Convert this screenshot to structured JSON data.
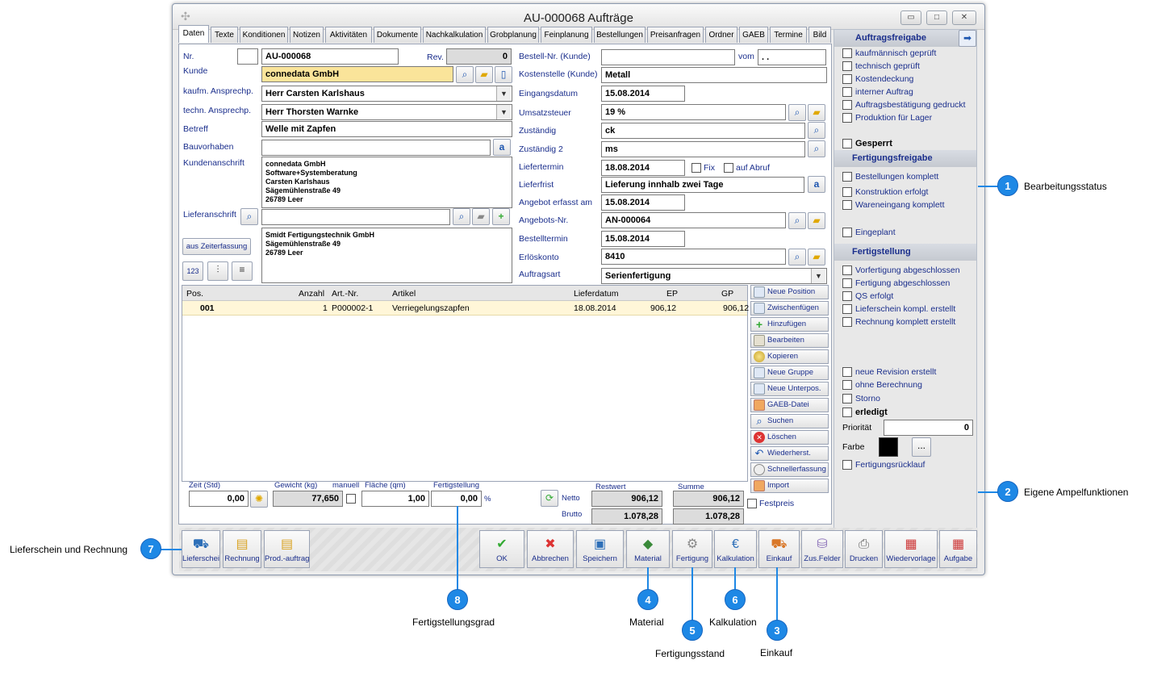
{
  "window": {
    "title": "AU-000068 Aufträge"
  },
  "tabs": [
    "Daten",
    "Texte",
    "Konditionen",
    "Notizen",
    "Aktivitäten",
    "Dokumente",
    "Nachkalkulation",
    "Grobplanung",
    "Feinplanung",
    "Bestellungen",
    "Preisanfragen",
    "Ordner",
    "GAEB",
    "Termine",
    "Bild"
  ],
  "left": {
    "nr_label": "Nr.",
    "nr_value": "AU-000068",
    "rev_label": "Rev.",
    "rev_value": "0",
    "kunde_label": "Kunde",
    "kunde_value": "connedata GmbH",
    "kaufm_label": "kaufm. Ansprechp.",
    "kaufm_value": "Herr Carsten Karlshaus",
    "techn_label": "techn. Ansprechp.",
    "techn_value": "Herr Thorsten Warnke",
    "betreff_label": "Betreff",
    "betreff_value": "Welle mit Zapfen",
    "bau_label": "Bauvorhaben",
    "bau_value": "",
    "kundenanschrift_label": "Kundenanschrift",
    "kundenanschrift_value": "connedata GmbH\nSoftware+Systemberatung\nCarsten Karlshaus\nSägemühlenstraße 49\n26789 Leer",
    "liefer_label": "Lieferanschrift",
    "liefer_value": "",
    "lieferanschrift_text": "Smidt Fertigungstechnik GmbH\nSägemühlenstraße 49\n26789 Leer",
    "zeiterfassung_button": "aus Zeiterfassung",
    "btn_123": "123"
  },
  "mid": {
    "bestellnr_label": "Bestell-Nr. (Kunde)",
    "bestellnr_value": "",
    "vom_label": "vom",
    "vom_value": ". .",
    "kst_label": "Kostenstelle (Kunde)",
    "kst_value": "Metall",
    "eingang_label": "Eingangsdatum",
    "eingang_value": "15.08.2014",
    "ust_label": "Umsatzsteuer",
    "ust_value": "19 %",
    "zust_label": "Zuständig",
    "zust_value": "ck",
    "zust2_label": "Zuständig 2",
    "zust2_value": "ms",
    "liefertermin_label": "Liefertermin",
    "liefertermin_value": "18.08.2014",
    "fix_label": "Fix",
    "abruf_label": "auf Abruf",
    "lieferfrist_label": "Lieferfrist",
    "lieferfrist_value": "Lieferung innhalb zwei Tage",
    "angebot_erfasst_label": "Angebot erfasst am",
    "angebot_erfasst_value": "15.08.2014",
    "angebotsnr_label": "Angebots-Nr.",
    "angebotsnr_value": "AN-000064",
    "bestelltermin_label": "Bestelltermin",
    "bestelltermin_value": "15.08.2014",
    "erloes_label": "Erlöskonto",
    "erloes_value": "8410",
    "auftragsart_label": "Auftragsart",
    "auftragsart_value": "Serienfertigung"
  },
  "grid": {
    "headers": {
      "pos": "Pos.",
      "anzahl": "Anzahl",
      "artnr": "Art.-Nr.",
      "artikel": "Artikel",
      "lieferdatum": "Lieferdatum",
      "ep": "EP",
      "gp": "GP"
    },
    "row": {
      "pos": "001",
      "anzahl": "1",
      "artnr": "P000002-1",
      "artikel": "Verriegelungszapfen",
      "lieferdatum": "18.08.2014",
      "ep": "906,12",
      "gp": "906,12"
    }
  },
  "side_buttons": [
    "Neue Position",
    "Zwischenfügen",
    "Hinzufügen",
    "Bearbeiten",
    "Kopieren",
    "Neue Gruppe",
    "Neue Unterpos.",
    "GAEB-Datei",
    "Suchen",
    "Löschen",
    "Wiederherst.",
    "Schnellerfassung",
    "Import"
  ],
  "footer": {
    "zeit_label": "Zeit (Std)",
    "zeit_value": "0,00",
    "gewicht_label": "Gewicht (kg)",
    "gewicht_value": "77,650",
    "manuell_label": "manuell",
    "flaeche_label": "Fläche (qm)",
    "flaeche_value": "1,00",
    "fertig_label": "Fertigstellung",
    "fertig_value": "0,00",
    "percent": "%",
    "netto_label": "Netto",
    "brutto_label": "Brutto",
    "restwert_label": "Restwert",
    "summe_label": "Summe",
    "rest_netto": "906,12",
    "rest_brutto": "1.078,28",
    "sum_netto": "906,12",
    "sum_brutto": "1.078,28",
    "festpreis_label": "Festpreis"
  },
  "right": {
    "h1": "Auftragsfreigabe",
    "items1": [
      "kaufmännisch geprüft",
      "technisch geprüft",
      "Kostendeckung",
      "interner Auftrag",
      "Auftragsbestätigung gedruckt",
      "Produktion für Lager"
    ],
    "gesperrt": "Gesperrt",
    "h2": "Fertigungsfreigabe",
    "items2": [
      "Bestellungen komplett",
      "Konstruktion erfolgt",
      "Wareneingang komplett"
    ],
    "eingeplant": "Eingeplant",
    "h3": "Fertigstellung",
    "items3": [
      "Vorfertigung abgeschlossen",
      "Fertigung abgeschlossen",
      "QS erfolgt",
      "Lieferschein kompl. erstellt",
      "Rechnung komplett erstellt"
    ],
    "items4": [
      "neue Revision erstellt",
      "ohne Berechnung",
      "Storno"
    ],
    "erledigt": "erledigt",
    "prioritaet_label": "Priorität",
    "prioritaet_value": "0",
    "farbe_label": "Farbe",
    "farbe_btn": "...",
    "farbe_color": "#000000",
    "ruecklauf": "Fertigungsrücklauf"
  },
  "bottom_left": [
    "Lieferschei",
    "Rechnung",
    "Prod.-auftrag"
  ],
  "bottom_right": [
    "OK",
    "Abbrechen",
    "Speichern",
    "Material",
    "Fertigung",
    "Kalkulation",
    "Einkauf",
    "Zus.Felder",
    "Drucken",
    "Wiedervorlage",
    "Aufgabe"
  ],
  "callouts": [
    {
      "num": "1",
      "text": "Bearbeitungsstatus"
    },
    {
      "num": "2",
      "text": "Eigene Ampelfunktionen"
    },
    {
      "num": "3",
      "text": "Einkauf"
    },
    {
      "num": "4",
      "text": "Material"
    },
    {
      "num": "5",
      "text": "Fertigungsstand"
    },
    {
      "num": "6",
      "text": "Kalkulation"
    },
    {
      "num": "7",
      "text": "Lieferschein und Rechnung"
    },
    {
      "num": "8",
      "text": "Fertigstellungsgrad"
    }
  ],
  "colors": {
    "accent": "#1e88e5",
    "label": "#1a2e8c",
    "kunde_bg": "#fae49a"
  }
}
